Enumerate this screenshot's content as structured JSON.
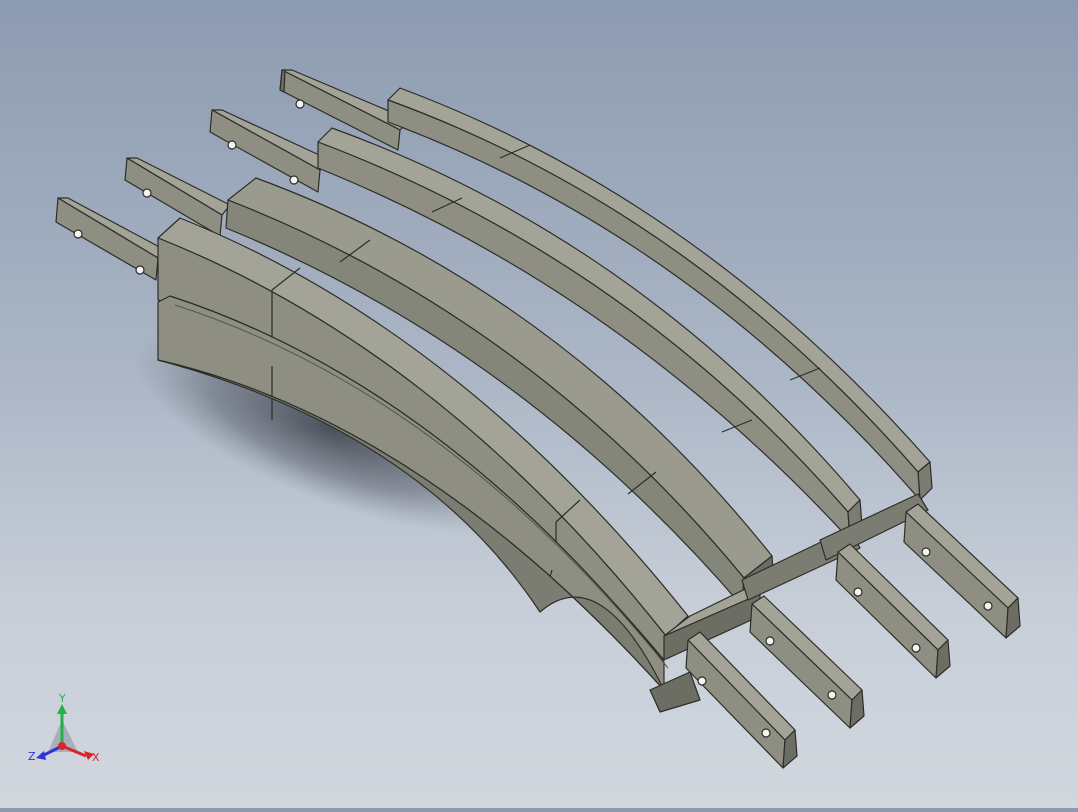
{
  "viewport": {
    "background_top": "#8d9bb1",
    "background_bottom": "#d2d7de",
    "model_color": "#8e8f82",
    "model_color_light": "#a3a497",
    "model_color_dark": "#6d6e63",
    "edge_color": "#2c2d27"
  },
  "triad": {
    "x_label": "X",
    "y_label": "Y",
    "z_label": "Z",
    "x_color": "#d8262a",
    "y_color": "#22b14c",
    "z_color": "#2d35d8"
  }
}
